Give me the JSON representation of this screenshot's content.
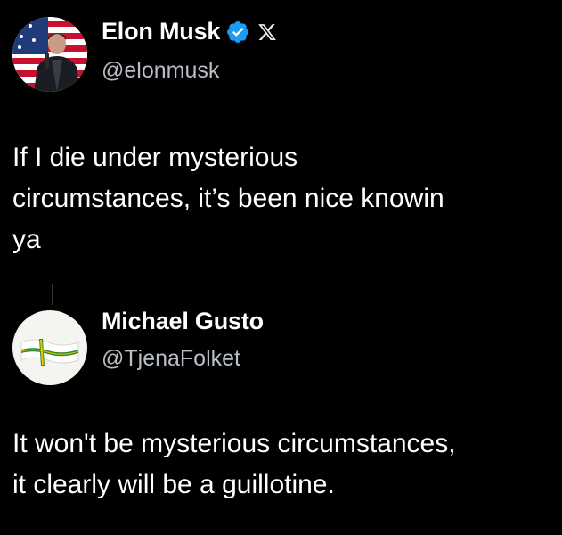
{
  "colors": {
    "background": "#000000",
    "text": "#ffffff",
    "handle": "#b9bec4",
    "verified": "#1d9bf0"
  },
  "tweet": {
    "author_name": "Elon Musk",
    "author_handle": "@elonmusk",
    "verified_icon": "verified-badge-icon",
    "platform_icon": "x-logo-icon",
    "text": "If I die under mysterious\ncircumstances, it’s been nice knowin\nya"
  },
  "reply": {
    "author_name": "Michael Gusto",
    "author_handle": "@TjenaFolket",
    "text": "It won't be mysterious circumstances,\nit clearly will be a guillotine."
  }
}
